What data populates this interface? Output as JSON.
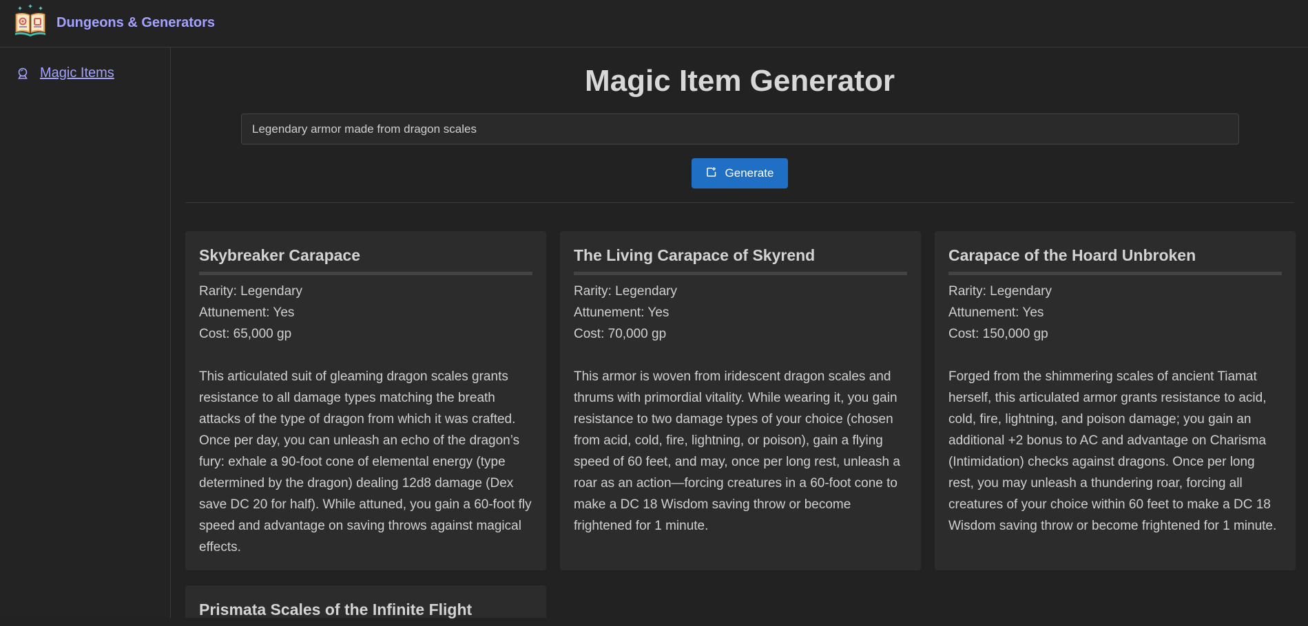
{
  "header": {
    "brand": "Dungeons & Generators",
    "logo_icon": "spellbook-icon"
  },
  "sidebar": {
    "items": [
      {
        "label": "Magic Items",
        "icon": "crystal-ball-icon"
      }
    ]
  },
  "main": {
    "title": "Magic Item Generator",
    "prompt_value": "Legendary armor made from dragon scales",
    "generate_label": "Generate",
    "generate_icon": "refresh-icon",
    "accent_color": "#1f6fc5",
    "link_color": "#a5a2ff"
  },
  "items": [
    {
      "name": "Skybreaker Carapace",
      "rarity": "Rarity: Legendary",
      "attunement": "Attunement: Yes",
      "cost": "Cost: 65,000 gp",
      "description": "This articulated suit of gleaming dragon scales grants resistance to all damage types matching the breath attacks of the type of dragon from which it was crafted. Once per day, you can unleash an echo of the dragon’s fury: exhale a 90-foot cone of elemental energy (type determined by the dragon) dealing 12d8 damage (Dex save DC 20 for half). While attuned, you gain a 60-foot fly speed and advantage on saving throws against magical effects."
    },
    {
      "name": "The Living Carapace of Skyrend",
      "rarity": "Rarity: Legendary",
      "attunement": "Attunement: Yes",
      "cost": "Cost: 70,000 gp",
      "description": "This armor is woven from iridescent dragon scales and thrums with primordial vitality. While wearing it, you gain resistance to two damage types of your choice (chosen from acid, cold, fire, lightning, or poison), gain a flying speed of 60 feet, and may, once per long rest, unleash a roar as an action—forcing creatures in a 60-foot cone to make a DC 18 Wisdom saving throw or become frightened for 1 minute."
    },
    {
      "name": "Carapace of the Hoard Unbroken",
      "rarity": "Rarity: Legendary",
      "attunement": "Attunement: Yes",
      "cost": "Cost: 150,000 gp",
      "description": "Forged from the shimmering scales of ancient Tiamat herself, this articulated armor grants resistance to acid, cold, fire, lightning, and poison damage; you gain an additional +2 bonus to AC and advantage on Charisma (Intimidation) checks against dragons. Once per long rest, you may unleash a thundering roar, forcing all creatures of your choice within 60 feet to make a DC 18 Wisdom saving throw or become frightened for 1 minute."
    },
    {
      "name": "Prismata Scales of the Infinite Flight"
    }
  ]
}
